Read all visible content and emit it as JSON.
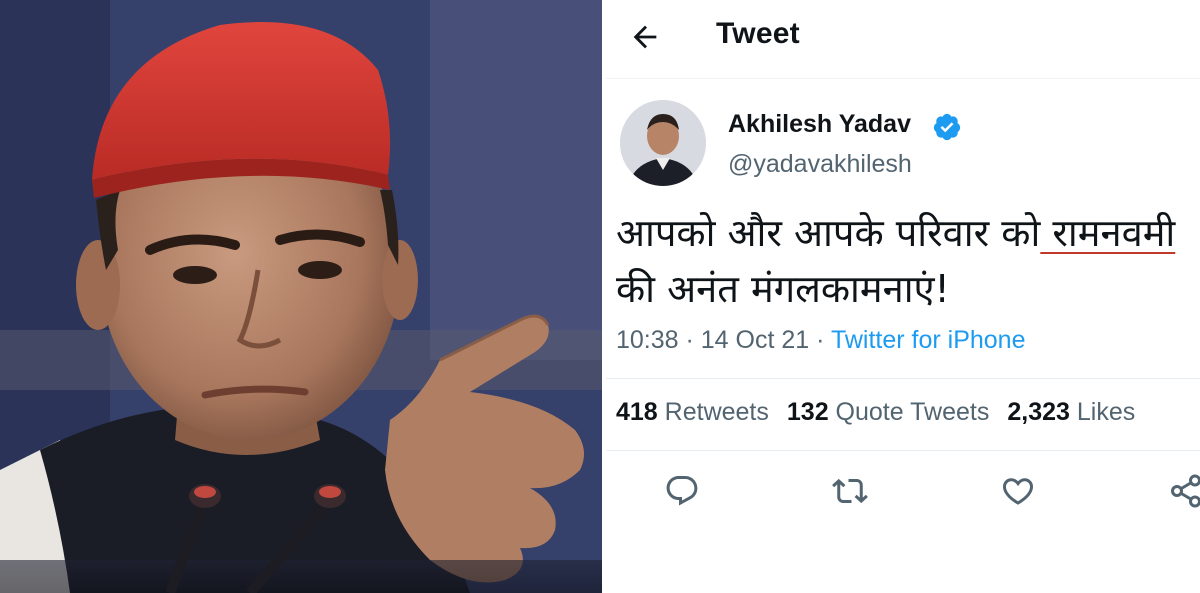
{
  "header": {
    "back_icon": "arrow-left-icon",
    "title": "Tweet"
  },
  "author": {
    "display_name": "Akhilesh Yadav",
    "handle": "@yadavakhilesh",
    "verified_icon": "verified-badge-icon",
    "verified_color": "#1d9bf0"
  },
  "tweet": {
    "line1_before": "आपको और आपके परिवार को",
    "line1_underlined": " रामनवमी",
    "line2": "की अनंत मंगलकामनाएं!",
    "time": "10:38",
    "date": "14 Oct 21",
    "source": "Twitter for iPhone",
    "separator": " · "
  },
  "stats": {
    "retweets_count": "418",
    "retweets_label": " Retweets",
    "quotes_count": "132",
    "quotes_label": " Quote Tweets",
    "likes_count": "2,323",
    "likes_label": " Likes"
  },
  "actions": {
    "reply_icon": "reply-icon",
    "retweet_icon": "retweet-icon",
    "like_icon": "heart-icon",
    "share_icon": "share-icon",
    "icon_color": "#536471"
  },
  "colors": {
    "link_blue": "#1d9bf0",
    "underline_red": "#c0392b",
    "text_dark": "#0f1419",
    "text_muted": "#536471"
  }
}
